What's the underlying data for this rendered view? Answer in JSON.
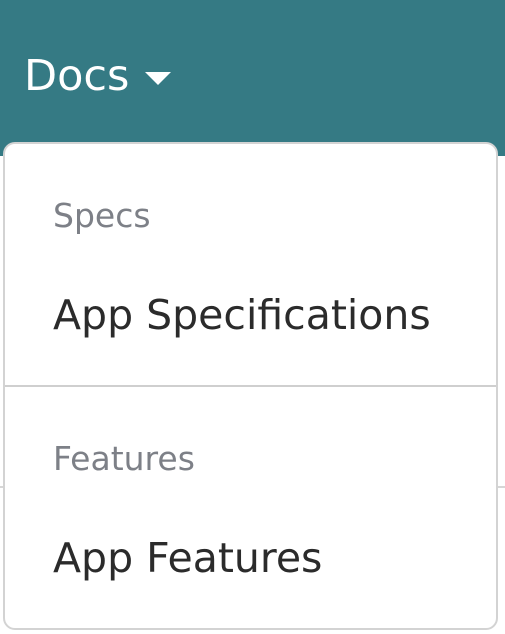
{
  "navbar": {
    "docs_label": "Docs",
    "background": "#357a84",
    "caret_icon": "caret-down-icon"
  },
  "dropdown": {
    "sections": [
      {
        "header": "Specs",
        "item": "App Specifications"
      },
      {
        "header": "Features",
        "item": "App Features"
      }
    ]
  }
}
